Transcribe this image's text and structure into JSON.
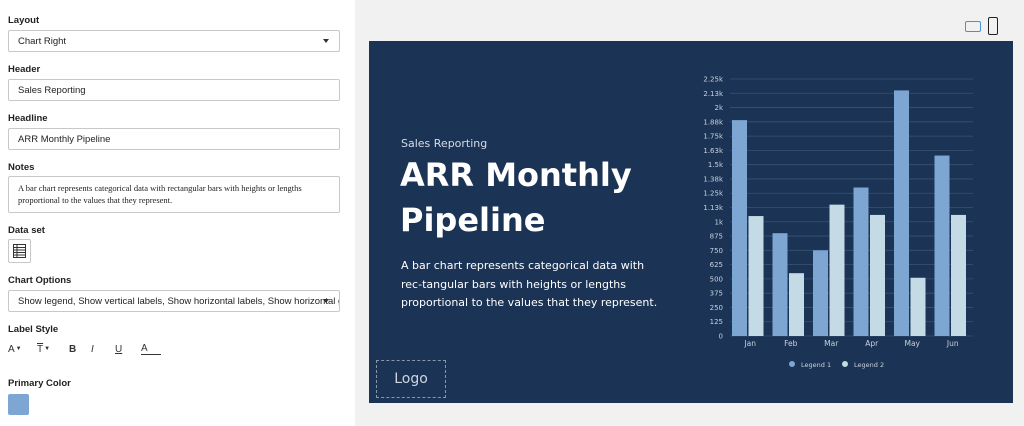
{
  "form": {
    "layout_label": "Layout",
    "layout_value": "Chart Right",
    "header_label": "Header",
    "header_value": "Sales Reporting",
    "headline_label": "Headline",
    "headline_value": "ARR Monthly Pipeline",
    "notes_label": "Notes",
    "notes_value": "A bar chart represents categorical data with rectangular bars with heights or lengths proportional to the values that they represent.",
    "dataset_label": "Data set",
    "chart_options_label": "Chart Options",
    "chart_options_value": "Show legend, Show vertical labels, Show horizontal labels, Show horizontal gri",
    "label_style_label": "Label Style",
    "style_buttons": {
      "font_size": "A",
      "text_transform": "T",
      "bold": "B",
      "italic": "I",
      "underline": "U",
      "color": "A"
    },
    "primary_color_label": "Primary Color",
    "primary_color": "#7ea6d2"
  },
  "preview": {
    "device_icons": [
      "desktop-icon",
      "mobile-icon"
    ],
    "header": "Sales Reporting",
    "headline": "ARR Monthly Pipeline",
    "notes": "A bar chart represents categorical data with rec-tangular bars with heights or lengths proportional to the values that they represent.",
    "logo": "Logo",
    "background": "#1b3354"
  },
  "chart_data": {
    "type": "bar",
    "categories": [
      "Jan",
      "Feb",
      "Mar",
      "Apr",
      "May",
      "Jun"
    ],
    "series": [
      {
        "name": "Legend 1",
        "color": "#7ea6d2",
        "values": [
          1890,
          900,
          750,
          1300,
          2150,
          1580
        ]
      },
      {
        "name": "Legend 2",
        "color": "#c4dbe5",
        "values": [
          1050,
          550,
          1150,
          1060,
          510,
          1060
        ]
      }
    ],
    "ylim": [
      0,
      2250
    ],
    "yticks": [
      "0",
      "125",
      "250",
      "375",
      "500",
      "625",
      "750",
      "875",
      "1k",
      "1.13k",
      "1.25k",
      "1.38k",
      "1.5k",
      "1.63k",
      "1.75k",
      "1.88k",
      "2k",
      "2.13k",
      "2.25k"
    ],
    "grid": true,
    "legend_position": "bottom"
  }
}
